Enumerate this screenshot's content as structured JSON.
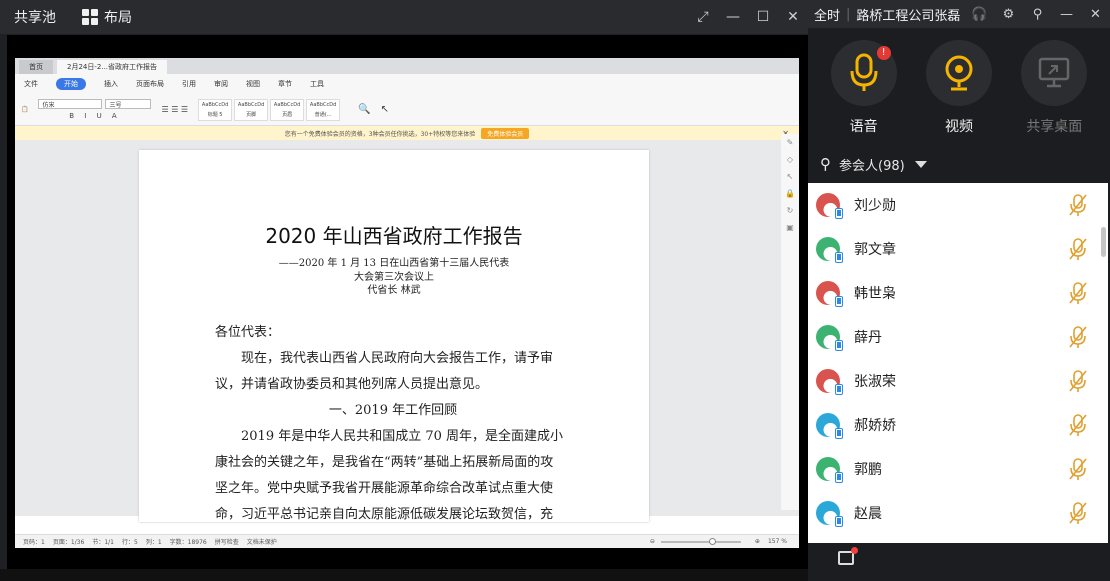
{
  "topbar": {
    "pool_label": "共享池",
    "layout_label": "布局"
  },
  "right_top": {
    "full_label": "全时",
    "title": "路桥工程公司张磊"
  },
  "doc": {
    "tabs": [
      "首页",
      "2月24日-2...省政府工作报告"
    ],
    "menu": [
      "文件",
      "开始",
      "插入",
      "页面布局",
      "引用",
      "审阅",
      "视图",
      "章节",
      "工具"
    ],
    "font_name": "仿宋",
    "font_size": "三号",
    "styles": [
      "标题 5",
      "页脚",
      "页眉",
      "普通(..."
    ],
    "notice_text": "您有一个免费体验会员的资格，3种会员任你挑选，30+特权等您来体验",
    "notice_btn": "免费体验会员",
    "title": "2020 年山西省政府工作报告",
    "sub1": "——2020 年 1 月 13 日在山西省第十三届人民代表",
    "sub2": "大会第三次会议上",
    "sub3": "代省长  林武",
    "para0": "各位代表：",
    "para1a": "现在，我代表山西省人民政府向大会报告工作，请予审",
    "para1b": "议，并请省政协委员和其他列席人员提出意见。",
    "heading1": "一、2019 年工作回顾",
    "para2a": "2019 年是中华人民共和国成立 70 周年，是全面建成小",
    "para2b": "康社会的关键之年，是我省在“两转”基础上拓展新局面的攻",
    "para2c": "坚之年。党中央赋予我省开展能源革命综合改革试点重大使",
    "para2d": "命，习近平总书记亲自向太原能源低碳发展论坛致贺信，充",
    "status": {
      "page": "页码：1",
      "pages": "页面：1/36",
      "section": "节：1/1",
      "row": "行：5",
      "col": "列：1",
      "words": "字数：18976",
      "spell": "拼写检查",
      "protect": "文档未保护",
      "zoom": "157 %"
    }
  },
  "controls": {
    "audio": "语音",
    "video": "视频",
    "share": "共享桌面"
  },
  "participants": {
    "header": "参会人(98)",
    "list": [
      {
        "name": "刘少勋",
        "color": "#d9534f"
      },
      {
        "name": "郭文章",
        "color": "#3cb371"
      },
      {
        "name": "韩世枭",
        "color": "#d9534f"
      },
      {
        "name": "薛丹",
        "color": "#3cb371"
      },
      {
        "name": "张淑荣",
        "color": "#d9534f"
      },
      {
        "name": "郝娇娇",
        "color": "#2ba8d8"
      },
      {
        "name": "郭鹏",
        "color": "#3cb371"
      },
      {
        "name": "赵晨",
        "color": "#2ba8d8"
      }
    ]
  },
  "colors": {
    "accent_orange": "#f5b400",
    "mic_off": "#e0a030"
  }
}
